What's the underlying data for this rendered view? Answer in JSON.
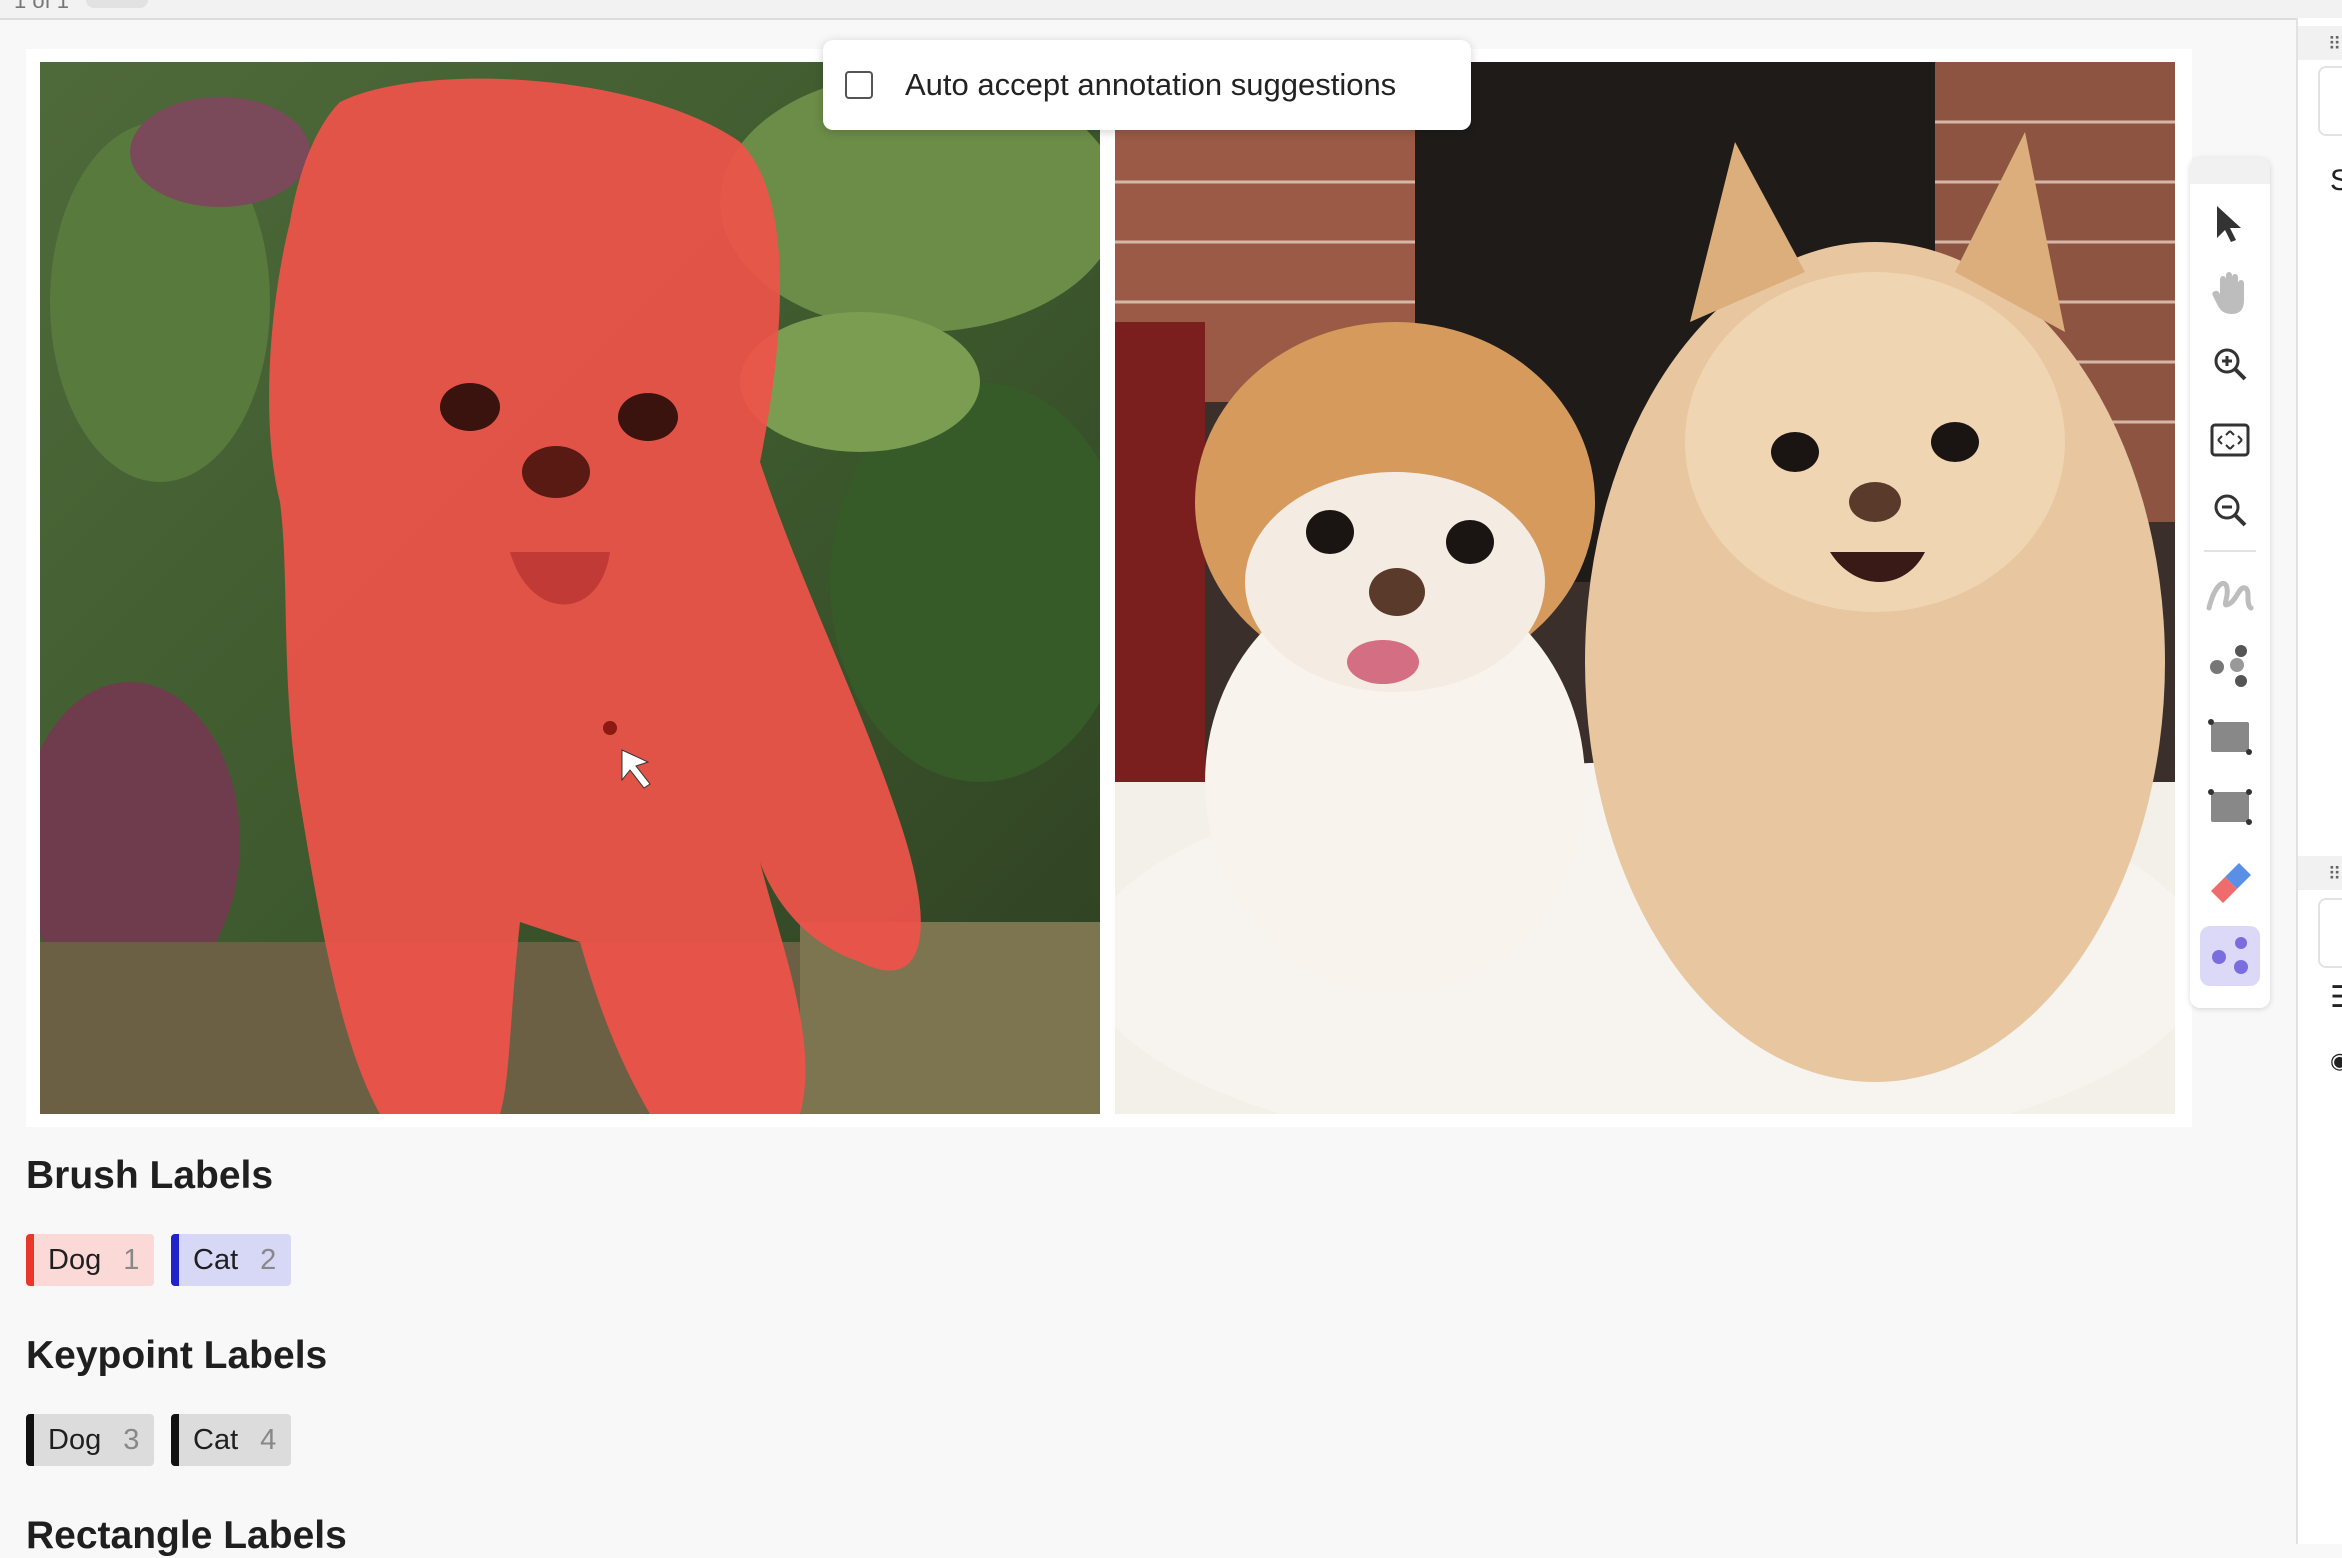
{
  "pagination": {
    "text": "1 of 1"
  },
  "suggestions": {
    "auto_accept_label": "Auto accept annotation suggestions",
    "checked": false
  },
  "toolbar": {
    "tools": [
      {
        "name": "select-icon"
      },
      {
        "name": "pan-icon"
      },
      {
        "name": "zoom-in-icon"
      },
      {
        "name": "fit-to-screen-icon"
      },
      {
        "name": "zoom-out-icon"
      },
      {
        "name": "brush-icon"
      },
      {
        "name": "keypoint-icon"
      },
      {
        "name": "rectangle-icon"
      },
      {
        "name": "rectangle-3-point-icon"
      },
      {
        "name": "eraser-icon"
      },
      {
        "name": "smart-keypoint-icon",
        "active": true
      }
    ]
  },
  "colors": {
    "dog_brush": "#e8382c",
    "cat_brush": "#1f23c9",
    "keypoint": "#111111",
    "active_tool_bg": "#dcd8f7",
    "mask": "#f0524a"
  },
  "sections": [
    {
      "title": "Brush Labels",
      "labels": [
        {
          "text": "Dog",
          "hotkey": "1"
        },
        {
          "text": "Cat",
          "hotkey": "2"
        }
      ]
    },
    {
      "title": "Keypoint Labels",
      "labels": [
        {
          "text": "Dog",
          "hotkey": "3"
        },
        {
          "text": "Cat",
          "hotkey": "4"
        }
      ]
    },
    {
      "title": "Rectangle Labels",
      "labels": []
    }
  ],
  "side_panel": {
    "letter": "S"
  }
}
